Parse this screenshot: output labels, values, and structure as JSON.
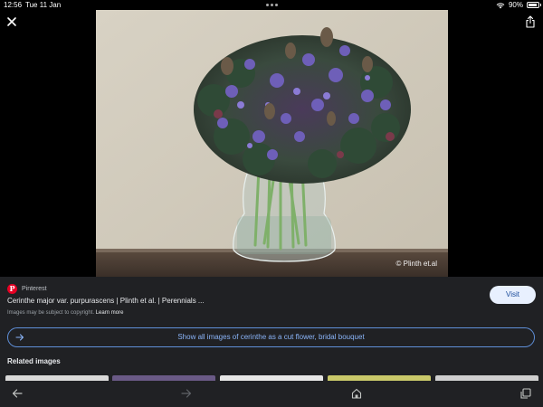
{
  "status_bar": {
    "time": "12:56",
    "date": "Tue 11 Jan",
    "battery": "90%"
  },
  "viewer": {
    "credit": "© Plinth et.al",
    "icons": {
      "close": "close-icon",
      "share": "share-icon"
    }
  },
  "result": {
    "source": "Pinterest",
    "title": "Cerinthe major var. purpurascens | Plinth et al. | Perennials ...",
    "copyright_note": "Images may be subject to copyright.",
    "learn_more": "Learn more",
    "visit_label": "Visit"
  },
  "show_all": {
    "label": "Show all images of cerinthe as a cut flower, bridal bouquet"
  },
  "related": {
    "heading": "Related images",
    "thumb_colors": [
      "#d9d9d9",
      "#6a5a86",
      "#e6e6e6",
      "#c9c86a",
      "#cfcfcf"
    ]
  },
  "toolbar": {
    "icons": [
      "back-arrow-icon",
      "forward-arrow-icon",
      "home-icon",
      "tabs-icon"
    ]
  },
  "colors": {
    "accent": "#8ab4f8",
    "panel_bg": "#202124",
    "visit_bg": "#e8f0fe",
    "pinterest": "#e60023"
  }
}
